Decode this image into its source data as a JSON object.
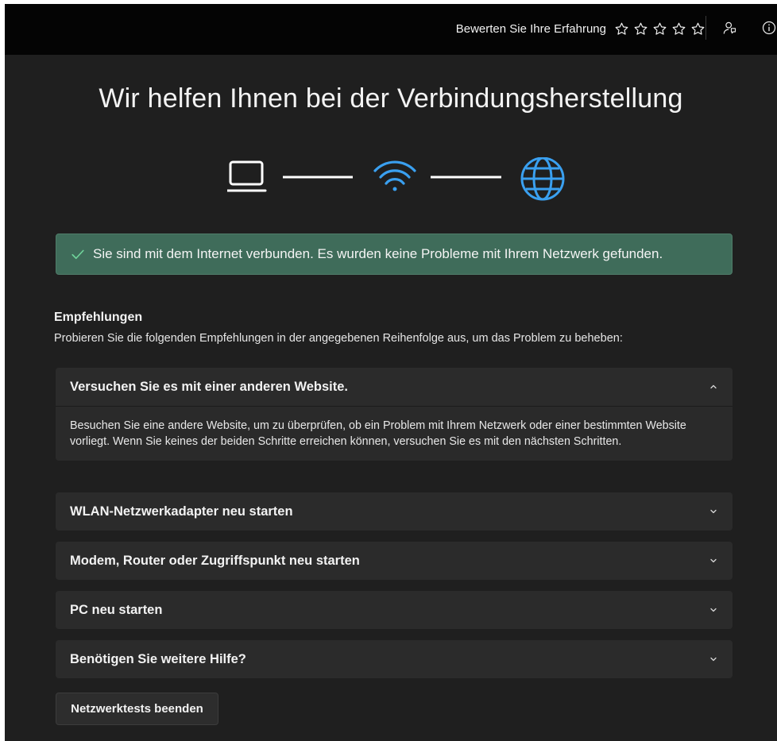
{
  "topbar": {
    "rate_label": "Bewerten Sie Ihre Erfahrung",
    "stars_total": 5,
    "stars_filled": 0
  },
  "title": "Wir helfen Ihnen bei der Verbindungsherstellung",
  "connection": {
    "icons": [
      "laptop-icon",
      "wifi-icon",
      "globe-icon"
    ],
    "colors": {
      "device": "#ffffff",
      "wifi": "#3aa0f0",
      "globe": "#3aa0f0",
      "line": "#ffffff"
    }
  },
  "status_banner": {
    "text": "Sie sind mit dem Internet verbunden. Es wurden keine Probleme mit Ihrem Netzwerk gefunden.",
    "color": "#3f6c5a",
    "icon": "check-icon"
  },
  "recommendations": {
    "title": "Empfehlungen",
    "description": "Probieren Sie die folgenden Empfehlungen in der angegebenen Reihenfolge aus, um das Problem zu beheben:",
    "items": [
      {
        "label": "Versuchen Sie es mit einer anderen Website.",
        "expanded": true,
        "body": "Besuchen Sie eine andere Website, um zu überprüfen, ob ein Problem mit Ihrem Netzwerk oder einer bestimmten Website vorliegt. Wenn Sie keines der beiden Schritte erreichen können, versuchen Sie es mit den nächsten Schritten."
      },
      {
        "label": "WLAN-Netzwerkadapter neu starten",
        "expanded": false
      },
      {
        "label": "Modem, Router oder Zugriffspunkt neu starten",
        "expanded": false
      },
      {
        "label": "PC neu starten",
        "expanded": false
      },
      {
        "label": "Benötigen Sie weitere Hilfe?",
        "expanded": false
      }
    ]
  },
  "end_button": "Netzwerktests beenden"
}
